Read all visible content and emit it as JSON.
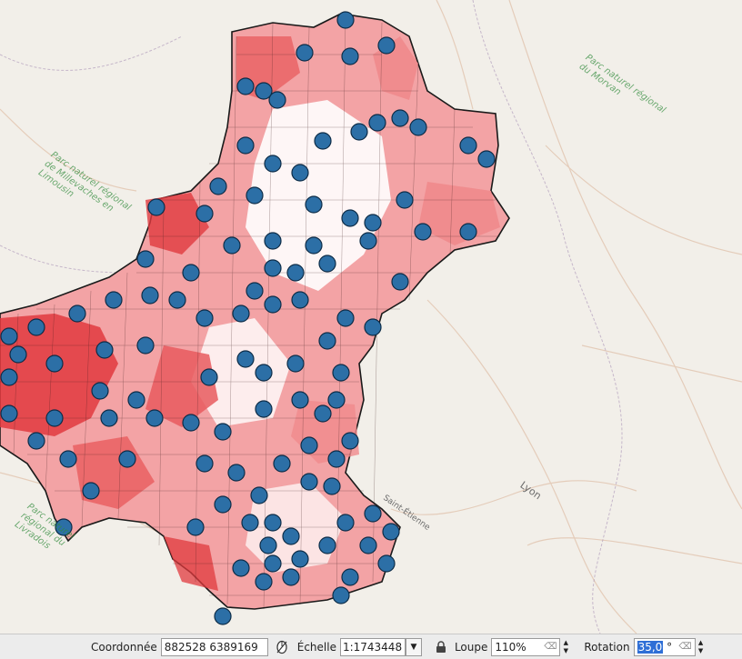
{
  "map": {
    "basemap_labels": {
      "park_morvan": "Parc naturel régional du Morvan",
      "park_millevaches": "Parc naturel régional de Millevaches en Limousin",
      "park_livradois": "Parc naturel régional du Livradois"
    },
    "cities": {
      "lyon": "Lyon",
      "saint_etienne": "Saint-Étienne"
    },
    "colors": {
      "region_dark": "#e03a3e",
      "region_mid": "#f08a8c",
      "region_light": "#f9c9ca",
      "region_white": "#ffffff",
      "point_fill": "#2c6fa6",
      "point_stroke": "#0d2c47"
    }
  },
  "statusbar": {
    "coord_label": "Coordonnée",
    "coord_value": "882528  6389169",
    "scale_label": "Échelle",
    "scale_value": "1:1743448",
    "magnifier_label": "Loupe",
    "magnifier_value": "110%",
    "rotation_label": "Rotation",
    "rotation_value": "35,0",
    "rotation_unit": "°"
  }
}
